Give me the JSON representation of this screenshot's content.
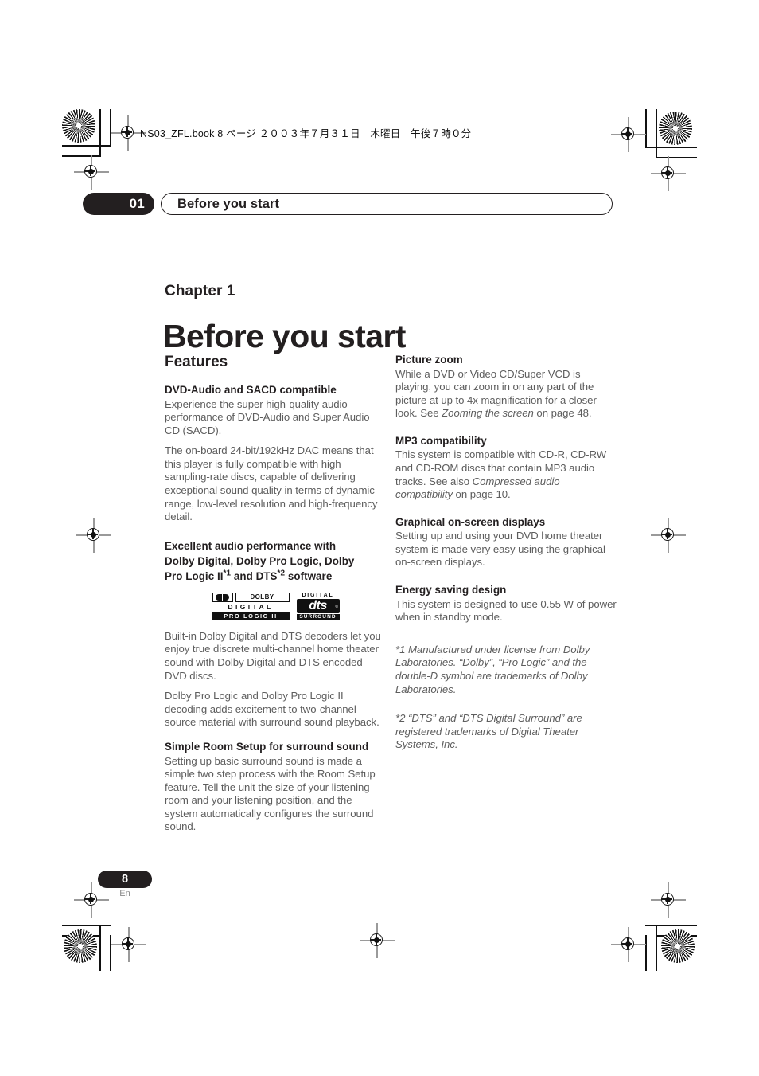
{
  "slug": "NS03_ZFL.book  8 ページ  ２００３年７月３１日　木曜日　午後７時０分",
  "running_head": {
    "number": "01",
    "title": "Before you start"
  },
  "title_block": {
    "chapter_label": "Chapter 1",
    "chapter_title": "Before you start"
  },
  "left_column": {
    "section_title": "Features",
    "blocks": [
      {
        "heading": "DVD-Audio and SACD compatible",
        "paragraph_1": "Experience the super high-quality audio performance of DVD-Audio and Super Audio CD (SACD).",
        "paragraph_2": "The on-board 24-bit/192kHz DAC means that this player is fully compatible with high sampling-rate discs, capable of delivering exceptional sound quality in terms of dynamic range, low-level resolution and high-frequency detail."
      },
      {
        "heading_line_1": "Excellent audio performance with",
        "heading_line_2": "Dolby Digital, Dolby Pro Logic, Dolby",
        "heading_line_3_a": "Pro Logic II",
        "heading_line_3_sup_1": "*1",
        "heading_line_3_b": " and DTS",
        "heading_line_3_sup_2": "*2",
        "heading_line_3_c": " software",
        "paragraph_1": "Built-in Dolby Digital and DTS decoders let you enjoy true discrete multi-channel home theater sound with Dolby Digital and DTS encoded DVD discs.",
        "paragraph_2": "Dolby Pro Logic and Dolby Pro Logic II decoding adds excitement to two-channel source material with surround sound playback."
      },
      {
        "heading": "Simple Room Setup for surround sound",
        "paragraph_1": "Setting up basic surround sound is made a simple two step process with the Room Setup feature. Tell the unit the size of your listening room and your listening position, and the system automatically configures the surround sound."
      }
    ],
    "logos": {
      "dolby": {
        "word": "DOLBY",
        "digital": "DIGITAL",
        "prologic": "PRO LOGIC II"
      },
      "dts": {
        "top": "DIGITAL",
        "mark": "dts",
        "bottom": "SURROUND"
      }
    }
  },
  "right_column": {
    "blocks": [
      {
        "heading": "Picture zoom",
        "paragraph_a": "While a DVD or Video CD/Super VCD is playing, you can zoom in on any part of the picture at up to 4x magnification for a closer look. See ",
        "paragraph_italic": "Zooming the screen",
        "paragraph_b": " on page 48."
      },
      {
        "heading": "MP3 compatibility",
        "paragraph_a": "This system is compatible with CD-R, CD-RW and CD-ROM discs that contain MP3 audio tracks. See also ",
        "paragraph_italic": "Compressed audio compatibility",
        "paragraph_b": " on page 10."
      },
      {
        "heading": "Graphical on-screen displays",
        "paragraph_a": "Setting up and using your DVD home theater system is made very easy using the graphical on-screen displays."
      },
      {
        "heading": "Energy saving design",
        "paragraph_a": "This system is designed to use 0.55 W of power when in standby mode."
      }
    ],
    "footnotes": [
      "*1   Manufactured under license from Dolby Laboratories. “Dolby”, “Pro Logic”  and the double-D symbol are trademarks of Dolby Laboratories.",
      "*2   “DTS” and “DTS Digital Surround” are registered trademarks of Digital Theater Systems, Inc."
    ]
  },
  "footer": {
    "page_number": "8",
    "language": "En"
  },
  "colors": {
    "ink": "#231f20",
    "body_text": "#5d5d5d",
    "page_background": "#ffffff"
  }
}
